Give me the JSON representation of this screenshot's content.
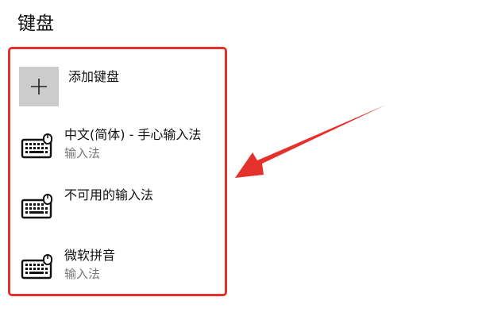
{
  "section": {
    "title": "键盘"
  },
  "add_keyboard": {
    "label": "添加键盘",
    "icon": "plus-icon"
  },
  "keyboards": [
    {
      "title": "中文(简体) - 手心输入法",
      "subtitle": "输入法",
      "icon": "keyboard-icon"
    },
    {
      "title": "不可用的输入法",
      "subtitle": "",
      "icon": "keyboard-icon"
    },
    {
      "title": "微软拼音",
      "subtitle": "输入法",
      "icon": "keyboard-icon"
    }
  ],
  "colors": {
    "highlight": "#e5312b",
    "tile_background": "#cccccc",
    "subtitle": "#777777"
  }
}
